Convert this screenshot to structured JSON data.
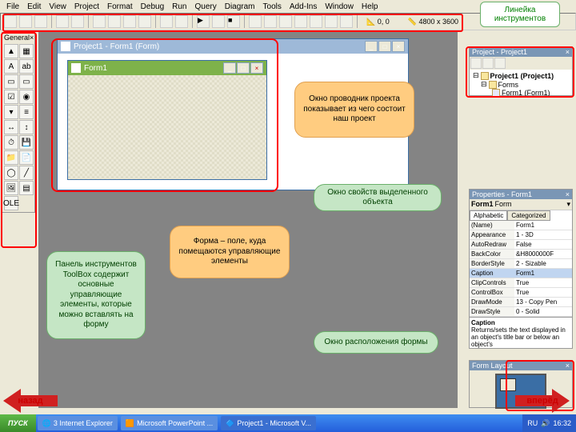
{
  "menu": [
    "File",
    "Edit",
    "View",
    "Project",
    "Format",
    "Debug",
    "Run",
    "Query",
    "Diagram",
    "Tools",
    "Add-Ins",
    "Window",
    "Help"
  ],
  "toolbar": {
    "coords": "0, 0",
    "canvas": "4800 x 3600"
  },
  "toolbox": {
    "title": "General",
    "close": "×"
  },
  "mdi": {
    "childTitle": "Project1 - Form1 (Form)",
    "formTitle": "Form1"
  },
  "projectExplorer": {
    "title": "Project - Project1",
    "root": "Project1 (Project1)",
    "folder": "Forms",
    "form": "Form1 (Form1)"
  },
  "properties": {
    "title": "Properties - Form1",
    "subject": "Form1",
    "subjectType": "Form",
    "tabs": [
      "Alphabetic",
      "Categorized"
    ],
    "rows": [
      {
        "k": "(Name)",
        "v": "Form1"
      },
      {
        "k": "Appearance",
        "v": "1 - 3D"
      },
      {
        "k": "AutoRedraw",
        "v": "False"
      },
      {
        "k": "BackColor",
        "v": "&H8000000F"
      },
      {
        "k": "BorderStyle",
        "v": "2 - Sizable"
      },
      {
        "k": "Caption",
        "v": "Form1",
        "sel": true
      },
      {
        "k": "ClipControls",
        "v": "True"
      },
      {
        "k": "ControlBox",
        "v": "True"
      },
      {
        "k": "DrawMode",
        "v": "13 - Copy Pen"
      },
      {
        "k": "DrawStyle",
        "v": "0 - Solid"
      }
    ],
    "captionHeader": "Caption",
    "captionHelp": "Returns/sets the text displayed in an object's title bar or below an object's"
  },
  "formLayout": {
    "title": "Form Layout"
  },
  "callouts": {
    "explorer": "Окно проводник проекта показывает из чего состоит наш проект",
    "props": "Окно свойств выделенного объекта",
    "form": "Форма – поле, куда помещаются управляющие элементы",
    "layout": "Окно расположения формы",
    "toolbox": "Панель инструментов ToolBox содержит основные управляющие элементы, которые можно вставлять на форму",
    "toolbar": "Линейка инструментов"
  },
  "nav": {
    "back": "назад",
    "fwd": "вперёд"
  },
  "taskbar": {
    "start": "ПУСК",
    "items": [
      "3 Internet Explorer",
      "Microsoft PowerPoint ...",
      "Project1 - Microsoft V..."
    ],
    "lang": "RU",
    "time": "16:32"
  },
  "colors": {
    "orange": "#ffcc80",
    "green": "#c5e6c5",
    "red": "#ff0000",
    "arrowtext": "#cc0000"
  }
}
